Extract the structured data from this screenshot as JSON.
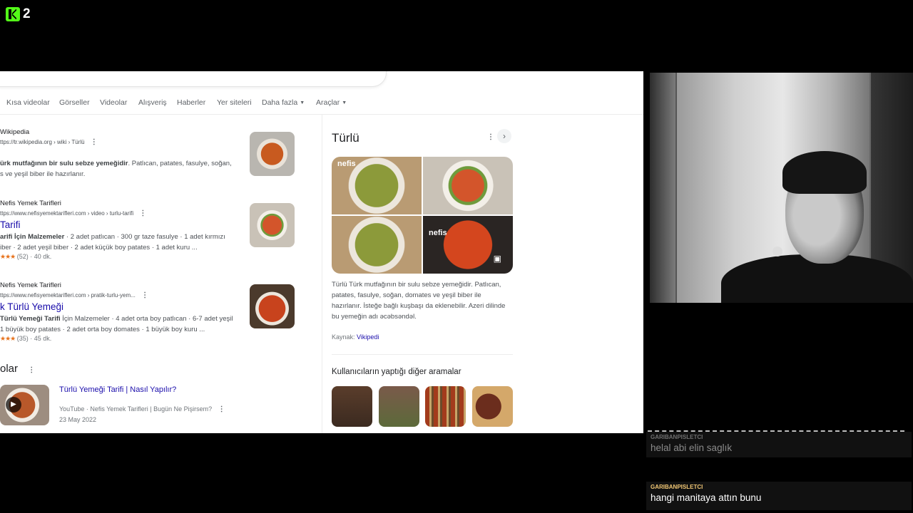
{
  "stream": {
    "logo_number": "2",
    "brand_color": "#53fc18"
  },
  "search": {
    "icons": [
      "close-icon",
      "keyboard-icon",
      "mic-icon",
      "lens-icon",
      "search-icon"
    ]
  },
  "tabs": [
    {
      "label": "Kısa videolar"
    },
    {
      "label": "Görseller"
    },
    {
      "label": "Videolar"
    },
    {
      "label": "Alışveriş"
    },
    {
      "label": "Haberler"
    },
    {
      "label": "Yer siteleri"
    },
    {
      "label": "Daha fazla"
    },
    {
      "label": "Araçlar"
    }
  ],
  "results": [
    {
      "source": "Wikipedia",
      "url": "ttps://tr.wikipedia.org › wiki › Türlü",
      "snippet_bold": "ürk mutfağının bir sulu sebze yemeğidir",
      "snippet_rest": ". Patlıcan, patates, fasulye, soğan,",
      "snippet2": "s ve yeşil biber ile hazırlanır."
    },
    {
      "source": "Nefis Yemek Tarifleri",
      "url": "ttps://www.nefisyemektarifleri.com › video › turlu-tarifi",
      "title": "Tarifi",
      "snippet_bold": "arifi İçin Malzemeler",
      "snippet_rest": " · 2 adet patlıcan · 300 gr taze fasulye · 1 adet kırmızı",
      "snippet2": "iber · 2 adet yeşil biber · 2 adet küçük boy patates · 1 adet kuru ...",
      "stars": "★★★",
      "rating": "(52)",
      "time": "· 40 dk."
    },
    {
      "source": "Nefis Yemek Tarifleri",
      "url": "ttps://www.nefisyemektarifleri.com › pratik-turlu-yem...",
      "title": "k Türlü Yemeği",
      "snippet_bold": "Türlü Yemeği Tarifi",
      "snippet_rest": " İçin Malzemeler · 4 adet orta boy patlıcan · 6-7 adet yeşil",
      "snippet2": "1 büyük boy patates · 2 adet orta boy domates · 1 büyük boy kuru ...",
      "stars": "★★★",
      "rating": "(35)",
      "time": "· 45 dk."
    }
  ],
  "videos": {
    "heading": "olar",
    "title": "Türlü Yemeği Tarifi | Nasıl Yapılır?",
    "channel": "YouTube · Nefis Yemek Tarifleri | Bugün Ne Pişirsem?",
    "date": "23 May 2022"
  },
  "knowledge_panel": {
    "title": "Türlü",
    "watermark": "nefis",
    "description": [
      "Türlü Türk mutfağının bir sulu sebze yemeğidir. Patlıcan,",
      "patates, fasulye, soğan, domates ve yeşil biber ile",
      "hazırlanır. İsteğe bağlı kuşbaşı da eklenebilir. Azeri dilinde",
      "bu yemeğin adı əcəbsəndəl."
    ],
    "source_label": "Kaynak:",
    "source_link": "Vikipedi",
    "related_heading": "Kullanıcıların yaptığı diğer aramalar"
  },
  "chat": [
    {
      "user": "GARIBANPISLETCI",
      "message": "helal abi elin saglık",
      "user_color": "#6f6f6f",
      "message_color": "#8a8a8a"
    },
    {
      "user": "GARIBANPISLETCI",
      "message": "hangi manitaya attın bunu",
      "user_color": "#f0c674",
      "message_color": "#ffffff"
    }
  ]
}
